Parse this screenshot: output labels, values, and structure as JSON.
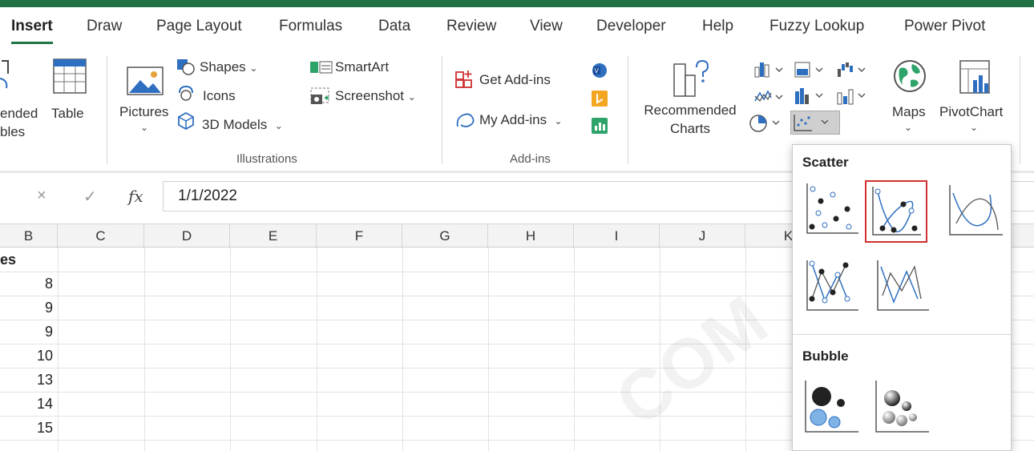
{
  "tabs": [
    "Insert",
    "Draw",
    "Page Layout",
    "Formulas",
    "Data",
    "Review",
    "View",
    "Developer",
    "Help",
    "Fuzzy Lookup",
    "Power Pivot"
  ],
  "ribbon": {
    "tables": {
      "recommended_partial_1": "ended",
      "recommended_partial_2": "bles",
      "table_label": "Table"
    },
    "illustrations": {
      "pictures": "Pictures",
      "shapes": "Shapes",
      "icons": "Icons",
      "models": "3D Models",
      "smartart": "SmartArt",
      "screenshot": "Screenshot",
      "group_label": "Illustrations"
    },
    "addins": {
      "get": "Get Add-ins",
      "my": "My Add-ins",
      "group_label": "Add-ins"
    },
    "charts": {
      "recommended_1": "Recommended",
      "recommended_2": "Charts",
      "maps": "Maps",
      "pivotchart": "PivotChart"
    }
  },
  "formula_bar": {
    "cancel": "×",
    "enter": "✓",
    "fx": "fx",
    "value": "1/1/2022"
  },
  "grid": {
    "columns": [
      "B",
      "C",
      "D",
      "E",
      "F",
      "G",
      "H",
      "I",
      "J",
      "K"
    ],
    "header_partial": "es",
    "values": [
      "8",
      "9",
      "9",
      "10",
      "13",
      "14",
      "15"
    ]
  },
  "dropdown": {
    "scatter_title": "Scatter",
    "bubble_title": "Bubble",
    "options": [
      "scatter",
      "scatter-smooth-markers",
      "scatter-smooth",
      "scatter-straight-markers",
      "scatter-straight",
      "bubble",
      "bubble-3d"
    ],
    "selected": "scatter-smooth-markers"
  },
  "watermark": "COM",
  "colors": {
    "accent": "#217346",
    "selection": "#d03030",
    "addin_blue": "#2f6fc0"
  }
}
